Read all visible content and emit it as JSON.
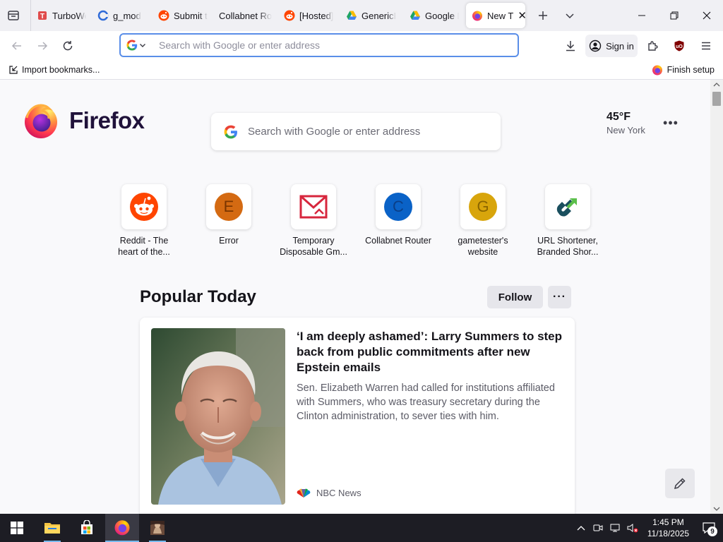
{
  "tabs": [
    {
      "label": "TurboWe",
      "favicon": "turbowebsite-icon"
    },
    {
      "label": "g_mod",
      "favicon": "gmod-icon"
    },
    {
      "label": "Submit t",
      "favicon": "reddit-icon"
    },
    {
      "label": "Collabnet Ro",
      "favicon": ""
    },
    {
      "label": "[Hosted]",
      "favicon": "reddit-icon"
    },
    {
      "label": "GenericI",
      "favicon": "google-drive-icon"
    },
    {
      "label": "Google D",
      "favicon": "google-drive-icon"
    },
    {
      "label": "New T",
      "favicon": "firefox-icon",
      "active": true
    }
  ],
  "urlbar": {
    "placeholder": "Search with Google or enter address",
    "value": ""
  },
  "toolbar": {
    "sign_in": "Sign in"
  },
  "bookmarks": {
    "import": "Import bookmarks...",
    "finish_setup": "Finish setup"
  },
  "newtab": {
    "brand": "Firefox",
    "search_placeholder": "Search with Google or enter address",
    "weather": {
      "temp": "45°F",
      "city": "New York"
    },
    "shortcuts": [
      {
        "label": "Reddit - The\nheart of the...",
        "icon": "reddit-icon"
      },
      {
        "label": "Error",
        "letter": "E",
        "color": "#d46a12",
        "text_color": "#7a3500"
      },
      {
        "label": "Temporary\nDisposable Gm...",
        "icon": "mail-icon"
      },
      {
        "label": "Collabnet Router",
        "letter": "C",
        "color": "#0a62c7",
        "text_color": "#0a3f88"
      },
      {
        "label": "gametester's\nwebsite",
        "letter": "G",
        "color": "#d8a50c",
        "text_color": "#8a6500"
      },
      {
        "label": "URL Shortener,\nBranded Shor...",
        "icon": "link-icon"
      }
    ],
    "popular": {
      "title": "Popular Today",
      "follow": "Follow",
      "menu": "···",
      "story": {
        "headline": "‘I am deeply ashamed’: Larry Summers to step back from public commitments after new Epstein emails",
        "excerpt": "Sen. Elizabeth Warren had called for institutions affiliated with Summers, who was treasury secretary during the Clinton administration, to sever ties with him.",
        "source": "NBC News"
      }
    }
  },
  "taskbar": {
    "time": "1:45 PM",
    "date": "11/18/2025",
    "notifications": "9"
  }
}
